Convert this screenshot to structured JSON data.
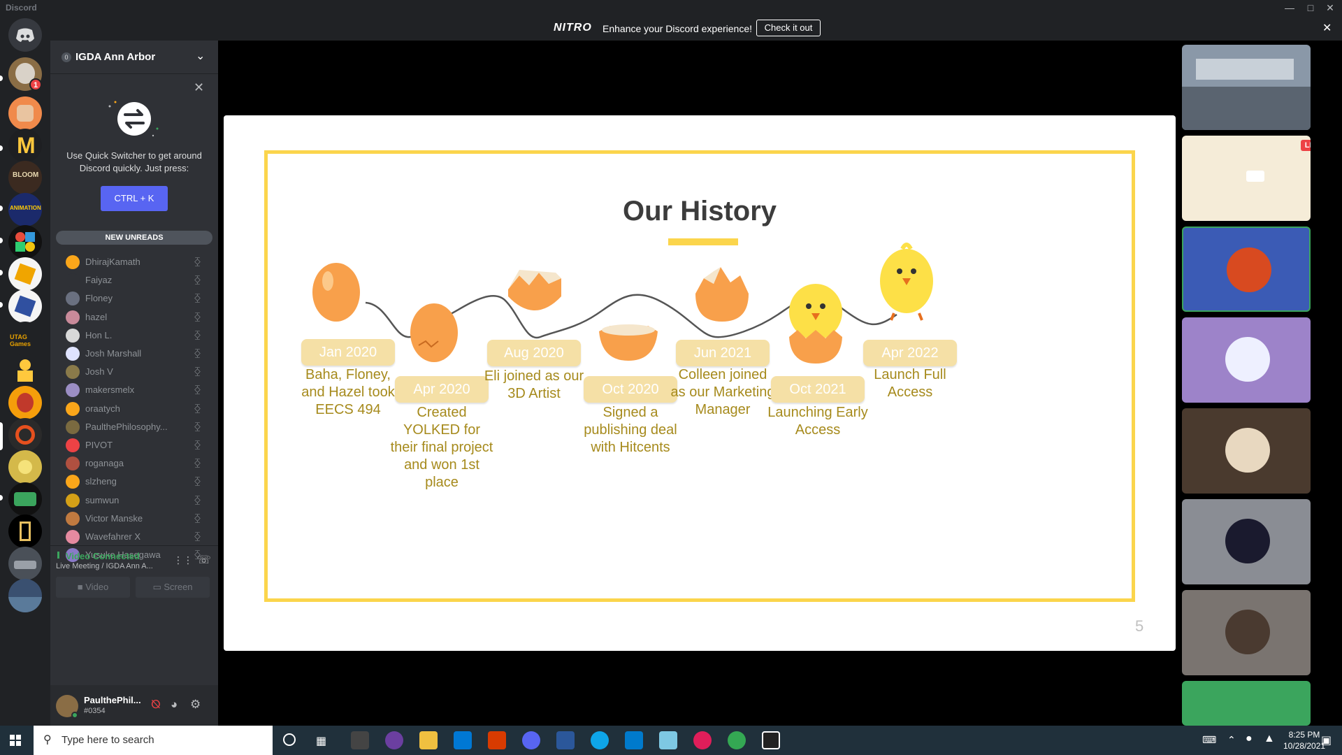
{
  "window": {
    "app_name": "Discord"
  },
  "nitro": {
    "logo": "NITRO",
    "message": "Enhance your Discord experience!",
    "cta": "Check it out"
  },
  "rail": {
    "badge_count": "1"
  },
  "guild": {
    "icon_text": "0",
    "name": "IGDA Ann Arbor"
  },
  "quick_switcher": {
    "text": "Use Quick Switcher to get around Discord quickly. Just press:",
    "shortcut": "CTRL + K"
  },
  "new_unreads": "NEW UNREADS",
  "members": [
    {
      "name": "DhirajKamath",
      "color": "#faa61a"
    },
    {
      "name": "Faiyaz",
      "color": "#2f3136"
    },
    {
      "name": "Floney",
      "color": "#6a7080"
    },
    {
      "name": "hazel",
      "color": "#c98a9a"
    },
    {
      "name": "Hon L.",
      "color": "#d8d8d8"
    },
    {
      "name": "Josh Marshall",
      "color": "#dfe3ff"
    },
    {
      "name": "Josh V",
      "color": "#8a7a4a"
    },
    {
      "name": "makersmelx",
      "color": "#9b8ec4"
    },
    {
      "name": "oraatych",
      "color": "#faa61a"
    },
    {
      "name": "PaulthePhilosophy...",
      "color": "#7a6a40"
    },
    {
      "name": "PIVOT",
      "color": "#ed4245"
    },
    {
      "name": "roganaga",
      "color": "#b05040"
    },
    {
      "name": "slzheng",
      "color": "#faa61a"
    },
    {
      "name": "sumwun",
      "color": "#d4a017"
    },
    {
      "name": "Victor Manske",
      "color": "#c07a40"
    },
    {
      "name": "Wavefahrer X",
      "color": "#e58aa0"
    },
    {
      "name": "Yusuke Hasegawa",
      "color": "#8a7ac8"
    }
  ],
  "voice": {
    "status": "Video Connected",
    "channel": "Live Meeting / IGDA Ann A...",
    "video_label": "Video",
    "screen_label": "Screen"
  },
  "user": {
    "name": "PaulthePhil...",
    "tag": "#0354"
  },
  "slide": {
    "title": "Our History",
    "page_number": "5",
    "milestones": [
      {
        "date": "Jan 2020",
        "text": "Baha, Floney, and Hazel took EECS 494"
      },
      {
        "date": "Apr 2020",
        "text": "Created YOLKED for their final project and won 1st place"
      },
      {
        "date": "Aug 2020",
        "text": "Eli joined as our 3D Artist"
      },
      {
        "date": "Oct 2020",
        "text": "Signed a publishing deal with Hitcents"
      },
      {
        "date": "Jun 2021",
        "text": "Colleen joined as our Marketing Manager"
      },
      {
        "date": "Oct 2021",
        "text": "Launching Early Access"
      },
      {
        "date": "Apr 2022",
        "text": "Launch Full Access"
      }
    ]
  },
  "tiles": {
    "live_label": "LIVE"
  },
  "taskbar": {
    "search_placeholder": "Type here to search",
    "time": "8:25 PM",
    "date": "10/28/2021"
  }
}
